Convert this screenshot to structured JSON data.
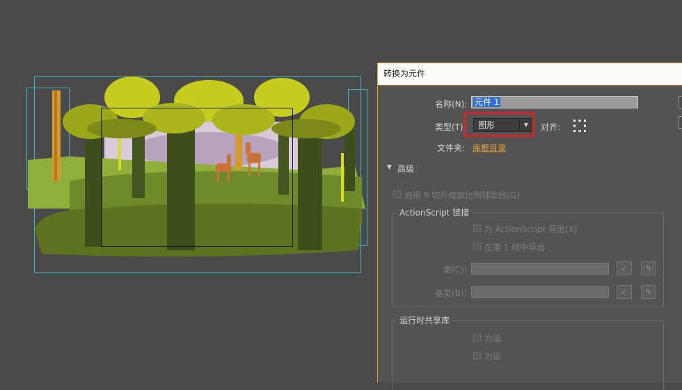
{
  "dialog": {
    "title": "转换为元件",
    "name_label": "名称(N):",
    "name_value": "元件 1",
    "type_label": "类型(T):",
    "type_value": "图形",
    "align_label": "对齐:",
    "folder_label": "文件夹:",
    "folder_value": "库根目录",
    "advanced_label": "高级",
    "scale9_label": "启用 9 切片缩放比例辅助线(G)",
    "actionscript_group": "ActionScript 链接",
    "export_actionscript": "为 ActionScript 导出(X)",
    "export_frame1": "在第 1 帧中导出",
    "class_label": "类(C):",
    "base_class_label": "基类(B):",
    "runtime_group": "运行时共享库",
    "runtime_item1": "为运",
    "runtime_item2": "为运"
  },
  "colors": {
    "highlight": "#d3242a",
    "accent": "#e8a23a",
    "guide": "#3fb7c4"
  },
  "icons": {
    "caret": "▼",
    "check": "✓",
    "pencil": "✎"
  }
}
